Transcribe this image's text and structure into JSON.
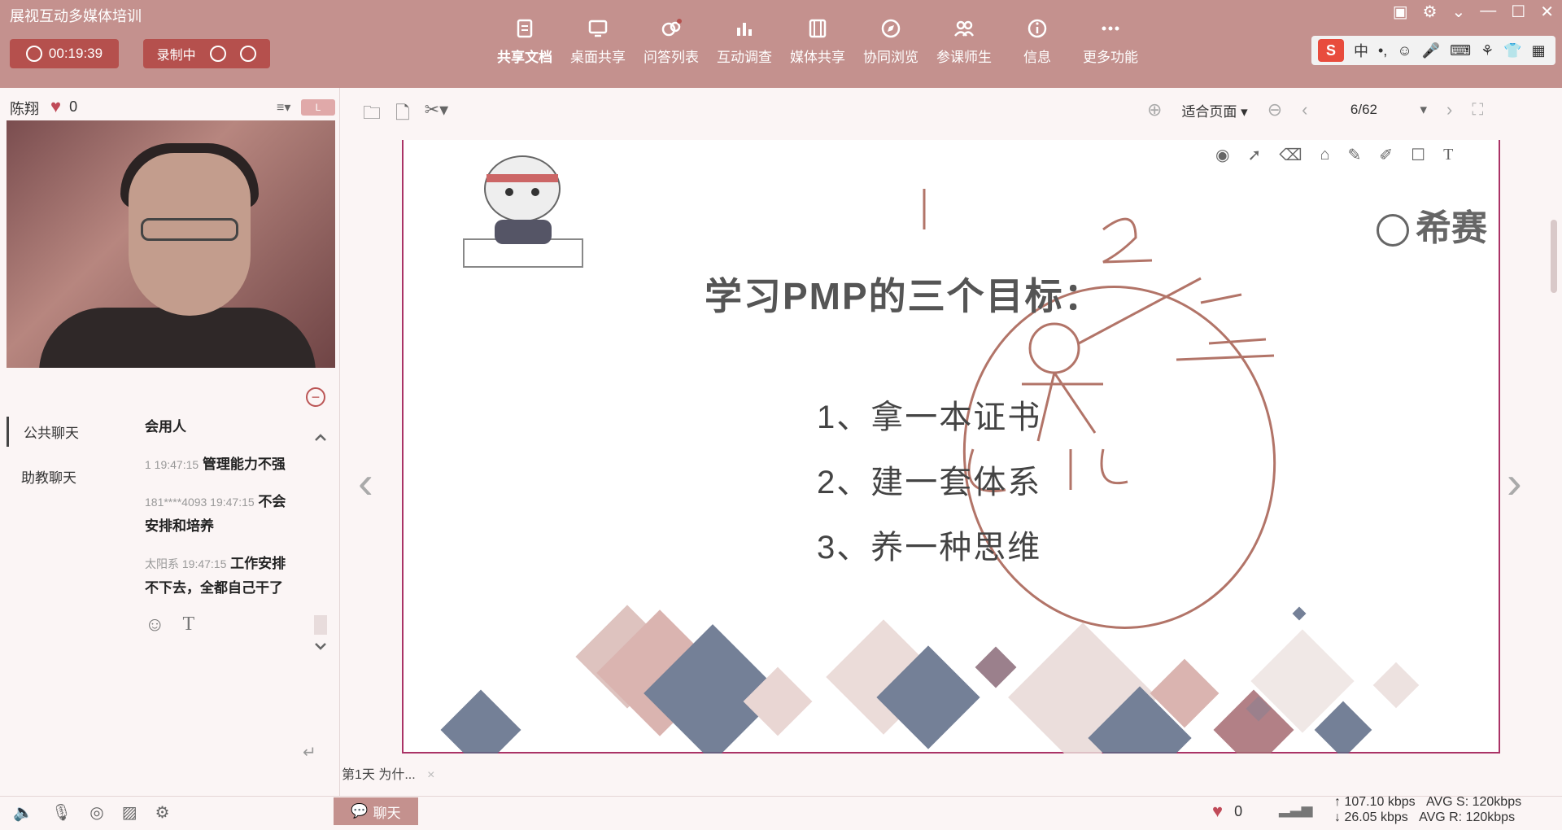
{
  "app": {
    "title": "展视互动多媒体培训"
  },
  "recording": {
    "timer": "00:19:39",
    "status": "录制中"
  },
  "toolbar": [
    {
      "label": "共享文档",
      "icon": "document-icon"
    },
    {
      "label": "桌面共享",
      "icon": "desktop-icon"
    },
    {
      "label": "问答列表",
      "icon": "qa-icon"
    },
    {
      "label": "互动调查",
      "icon": "survey-icon"
    },
    {
      "label": "媒体共享",
      "icon": "media-icon"
    },
    {
      "label": "协同浏览",
      "icon": "compass-icon"
    },
    {
      "label": "参课师生",
      "icon": "users-icon"
    },
    {
      "label": "信息",
      "icon": "info-icon"
    },
    {
      "label": "更多功能",
      "icon": "more-icon"
    }
  ],
  "presenter": {
    "name": "陈翔",
    "likes": "0"
  },
  "chat": {
    "tabs": [
      "公共聊天",
      "助教聊天"
    ],
    "messages": [
      {
        "meta": "",
        "text": "会用人"
      },
      {
        "meta": "1 19:47:15",
        "text": "管理能力不强"
      },
      {
        "meta": "181****4093 19:47:15",
        "text": "不会安排和培养"
      },
      {
        "meta": "太阳系 19:47:15",
        "text": "工作安排不下去，全都自己干了"
      }
    ]
  },
  "viewbar": {
    "zoom": "适合页面",
    "page": "6/62"
  },
  "slide": {
    "title": "学习PMP的三个目标：",
    "goals": [
      "1、拿一本证书",
      "2、建一套体系",
      "3、养一种思维"
    ],
    "logo": "希赛"
  },
  "bottom": {
    "course_tab": "第1天  为什...",
    "chat_button": "聊天",
    "hearts": "0",
    "up_rate": "107.10 kbps",
    "down_rate": "26.05 kbps",
    "avg_s": "AVG S: 120kbps",
    "avg_r": "AVG R: 120kbps"
  },
  "colors": {
    "topbar": "#c4918e",
    "pill": "#b5504d",
    "ink": "#b27468"
  }
}
